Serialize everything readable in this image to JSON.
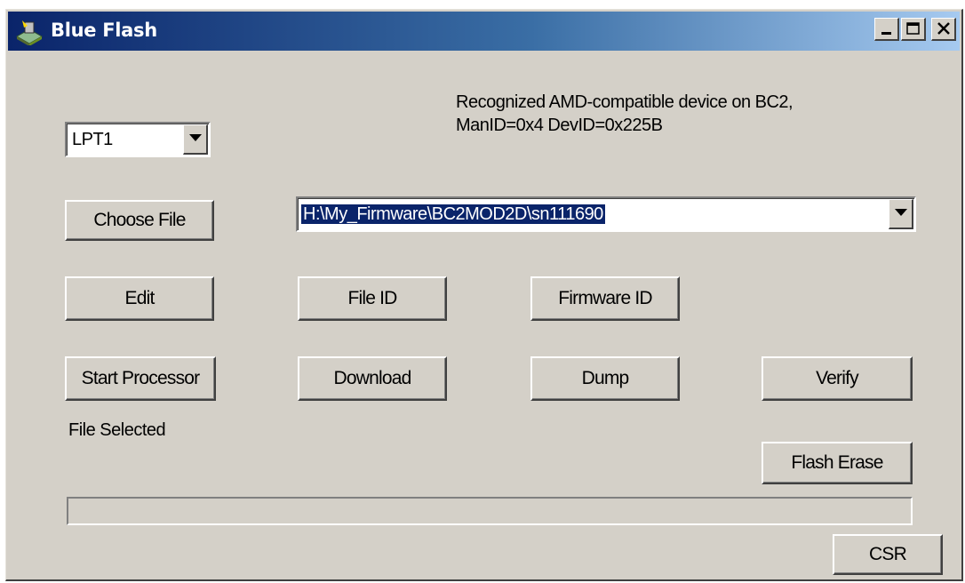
{
  "window": {
    "title": "Blue Flash",
    "icon": "blue-flash-app-icon",
    "controls": {
      "minimize": "minimize-icon",
      "maximize": "maximize-icon",
      "close": "close-icon"
    }
  },
  "status": {
    "device_line1": "Recognized AMD-compatible device on BC2,",
    "device_line2": "ManID=0x4 DevID=0x225B",
    "file_status": "File Selected"
  },
  "port_select": {
    "value": "LPT1"
  },
  "file_path": {
    "value": "H:\\My_Firmware\\BC2MOD2D\\sn111690"
  },
  "buttons": {
    "choose_file": "Choose File",
    "edit": "Edit",
    "file_id": "File ID",
    "firmware_id": "Firmware ID",
    "start_processor": "Start Processor",
    "download": "Download",
    "dump": "Dump",
    "verify": "Verify",
    "flash_erase": "Flash Erase",
    "csr": "CSR"
  },
  "progress": {
    "fraction": 0
  },
  "colors": {
    "face": "#d4d0c8",
    "title_start": "#0a246a",
    "title_end": "#a6caf0",
    "selection": "#0a246a"
  }
}
